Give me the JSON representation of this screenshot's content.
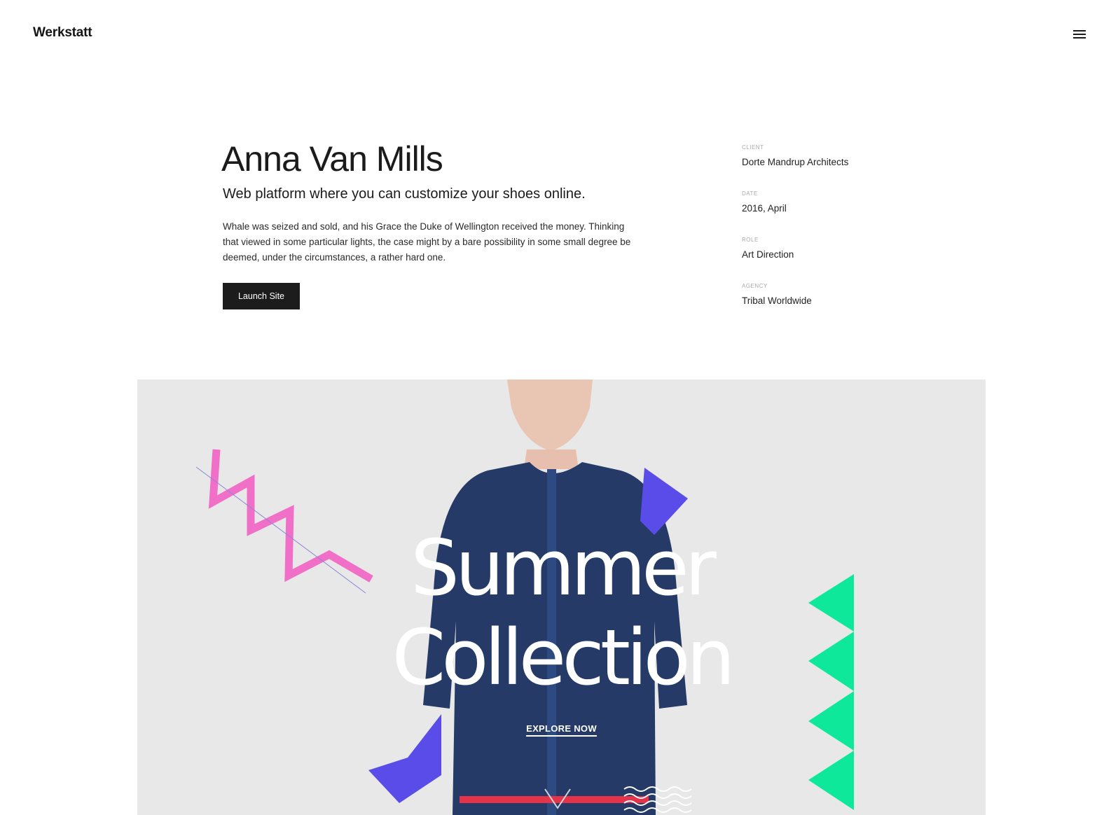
{
  "header": {
    "logo": "Werkstatt",
    "menu_icon": "hamburger-menu-icon"
  },
  "project": {
    "title": "Anna Van Mills",
    "subtitle": "Web platform where you can customize your shoes online.",
    "description": "Whale was seized and sold, and his Grace the Duke of Wellington received the money. Thinking that viewed in some particular lights, the case might by a bare possibility in some small degree be deemed, under the circumstances, a rather hard one.",
    "button_label": "Launch Site"
  },
  "meta": [
    {
      "label": "CLIENT",
      "value": "Dorte Mandrup Architects"
    },
    {
      "label": "DATE",
      "value": "2016, April"
    },
    {
      "label": "ROLE",
      "value": "Art Direction"
    },
    {
      "label": "AGENCY",
      "value": "Tribal Worldwide"
    }
  ],
  "hero": {
    "heading_line1": "Summer",
    "heading_line2": "Collection",
    "cta": "EXPLORE NOW",
    "colors": {
      "background": "#e8e8e8",
      "pink": "#f06fc7",
      "blue": "#5a4ce8",
      "green": "#0ee89a",
      "top": "#253a66"
    }
  }
}
